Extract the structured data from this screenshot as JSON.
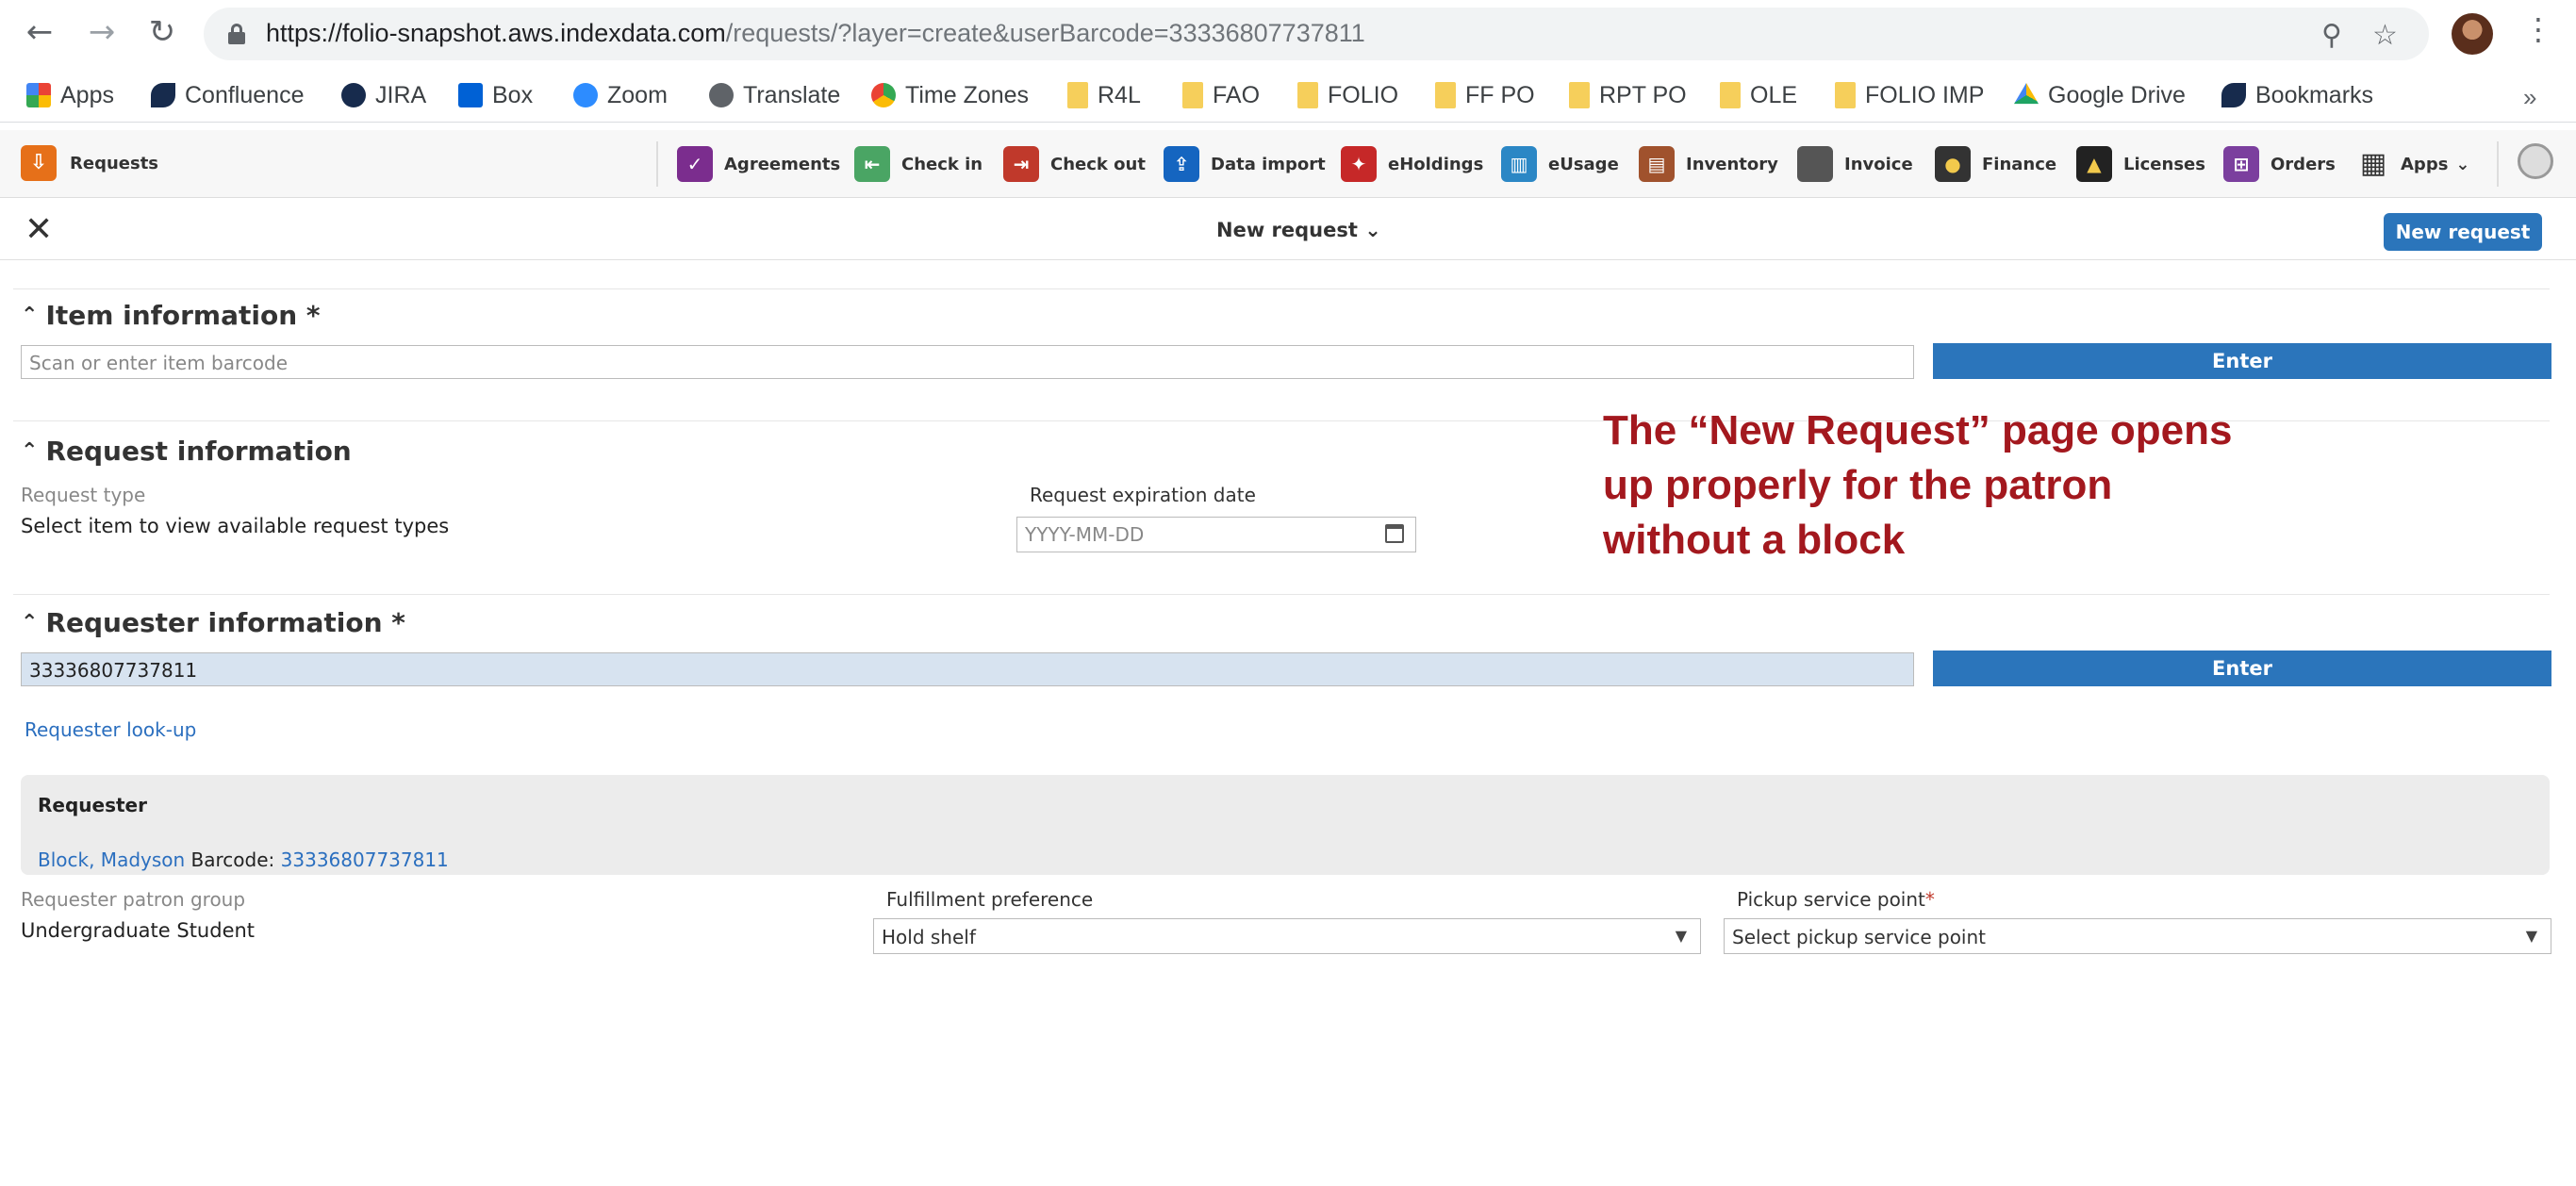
{
  "browser": {
    "url_main": "https://folio-snapshot.aws.indexdata.com",
    "url_rest": "/requests/?layer=create&userBarcode=33336807737811",
    "back_icon": "arrow-left-icon",
    "forward_icon": "arrow-right-icon",
    "reload_icon": "reload-icon",
    "zoom_icon": "zoom-icon",
    "star_icon": "star-icon"
  },
  "bookmarks": [
    {
      "label": "Apps",
      "icon": "apps-grid-icon",
      "color": "#e8453c"
    },
    {
      "label": "Confluence",
      "icon": "confluence-icon",
      "color": "#172b4d"
    },
    {
      "label": "JIRA",
      "icon": "jira-icon",
      "color": "#172b4d"
    },
    {
      "label": "Box",
      "icon": "box-icon",
      "color": "#0061d5"
    },
    {
      "label": "Zoom",
      "icon": "zoom-app-icon",
      "color": "#2d8cff"
    },
    {
      "label": "Translate",
      "icon": "globe-icon",
      "color": "#5f6368"
    },
    {
      "label": "Time Zones",
      "icon": "time-zones-icon",
      "color": "#34a853"
    },
    {
      "label": "R4L",
      "icon": "folder-icon",
      "color": "#f6cf5b"
    },
    {
      "label": "FAO",
      "icon": "folder-icon",
      "color": "#f6cf5b"
    },
    {
      "label": "FOLIO",
      "icon": "folder-icon",
      "color": "#f6cf5b"
    },
    {
      "label": "FF PO",
      "icon": "folder-icon",
      "color": "#f6cf5b"
    },
    {
      "label": "RPT PO",
      "icon": "folder-icon",
      "color": "#f6cf5b"
    },
    {
      "label": "OLE",
      "icon": "folder-icon",
      "color": "#f6cf5b"
    },
    {
      "label": "FOLIO IMP",
      "icon": "folder-icon",
      "color": "#f6cf5b"
    },
    {
      "label": "Google Drive",
      "icon": "google-drive-icon",
      "color": "#1fa463"
    },
    {
      "label": "Bookmarks",
      "icon": "confluence-icon",
      "color": "#172b4d"
    }
  ],
  "folio_nav": {
    "current_app": "Requests",
    "apps": [
      {
        "label": "Agreements",
        "color": "#7b2d8e",
        "glyph": "✓"
      },
      {
        "label": "Check in",
        "color": "#4aa564",
        "glyph": "⇤"
      },
      {
        "label": "Check out",
        "color": "#c0392b",
        "glyph": "⇥"
      },
      {
        "label": "Data import",
        "color": "#1565c0",
        "glyph": "⇪"
      },
      {
        "label": "eHoldings",
        "color": "#c62828",
        "glyph": "✦"
      },
      {
        "label": "eUsage",
        "color": "#2b87c5",
        "glyph": "▥"
      },
      {
        "label": "Inventory",
        "color": "#a0522d",
        "glyph": "▤"
      },
      {
        "label": "Invoice",
        "color": "#555555",
        "glyph": ""
      },
      {
        "label": "Finance",
        "color": "#333333",
        "glyph": "●"
      },
      {
        "label": "Licenses",
        "color": "#222222",
        "glyph": "▲"
      },
      {
        "label": "Orders",
        "color": "#7b3f9e",
        "glyph": "⊞"
      },
      {
        "label": "Apps",
        "color": "#ffffff",
        "glyph": "▦"
      }
    ]
  },
  "pane": {
    "title": "New request",
    "new_request_button": "New request"
  },
  "item_info": {
    "heading": "Item information *",
    "placeholder": "Scan or enter item barcode",
    "enter": "Enter"
  },
  "request_info": {
    "heading": "Request information",
    "type_label": "Request type",
    "type_value": "Select item to view available request types",
    "expiration_label": "Request expiration date",
    "expiration_placeholder": "YYYY-MM-DD"
  },
  "annotation": "The “New Request” page opens up properly for the patron without a block",
  "requester_info": {
    "heading": "Requester information *",
    "barcode_value": "33336807737811",
    "enter": "Enter",
    "lookup": "Requester look-up",
    "box_title": "Requester",
    "name": "Block, Madyson",
    "barcode_label": "Barcode:",
    "barcode": "33336807737811",
    "patron_group_label": "Requester patron group",
    "patron_group": "Undergraduate Student",
    "fulfillment_label": "Fulfillment preference",
    "fulfillment_value": "Hold shelf",
    "pickup_label": "Pickup service point",
    "pickup_required": "*",
    "pickup_value": "Select pickup service point"
  }
}
